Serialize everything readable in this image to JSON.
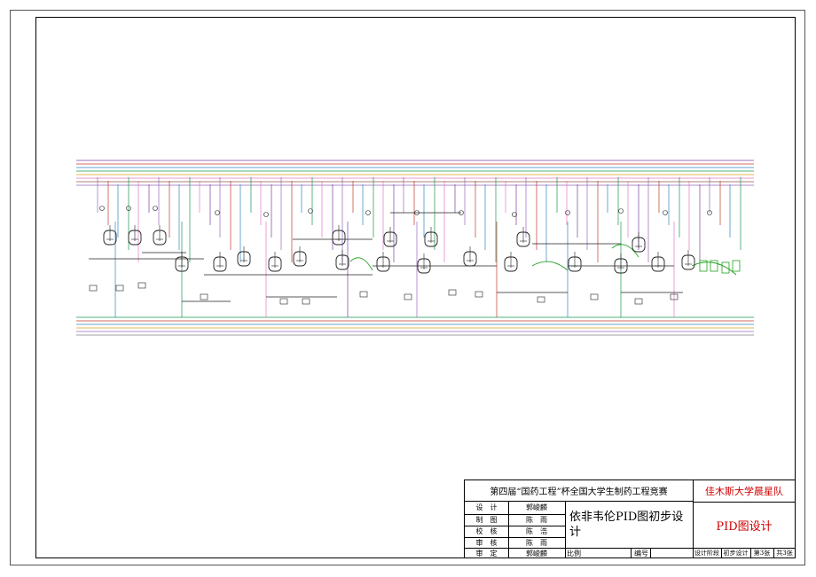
{
  "title_block": {
    "competition": "第四届“国药工程”杯全国大学生制药工程竞赛",
    "team": "佳木斯大学晨星队",
    "drawing_title": "依非韦伦PID图初步设计",
    "drawing_type": "PID图设计",
    "roles": [
      {
        "role": "设　计",
        "name": "郭峻麟"
      },
      {
        "role": "制　图",
        "name": "陈　雨"
      },
      {
        "role": "校　核",
        "name": "陈　浩"
      },
      {
        "role": "审　核",
        "name": "陈　雨"
      },
      {
        "role": "审　定",
        "name": "郭峻麟"
      }
    ],
    "scale_label": "比例",
    "number_label": "编号",
    "stage_label": "设计阶段",
    "stage_value": "初步设计",
    "sheet_no": "第3张",
    "sheet_total": "共3张"
  },
  "colors": {
    "header_lines": [
      "#7b3fa0",
      "#c0392b",
      "#2e86c1",
      "#1a9850",
      "#d4a017",
      "#e377c2",
      "#8c564b",
      "#9467bd"
    ],
    "footer_lines": [
      "#1a9850",
      "#c0392b",
      "#2e86c1",
      "#d4a017",
      "#9467bd",
      "#7f7f7f"
    ],
    "vessel": "#222222",
    "utility_green": "#22a022"
  }
}
